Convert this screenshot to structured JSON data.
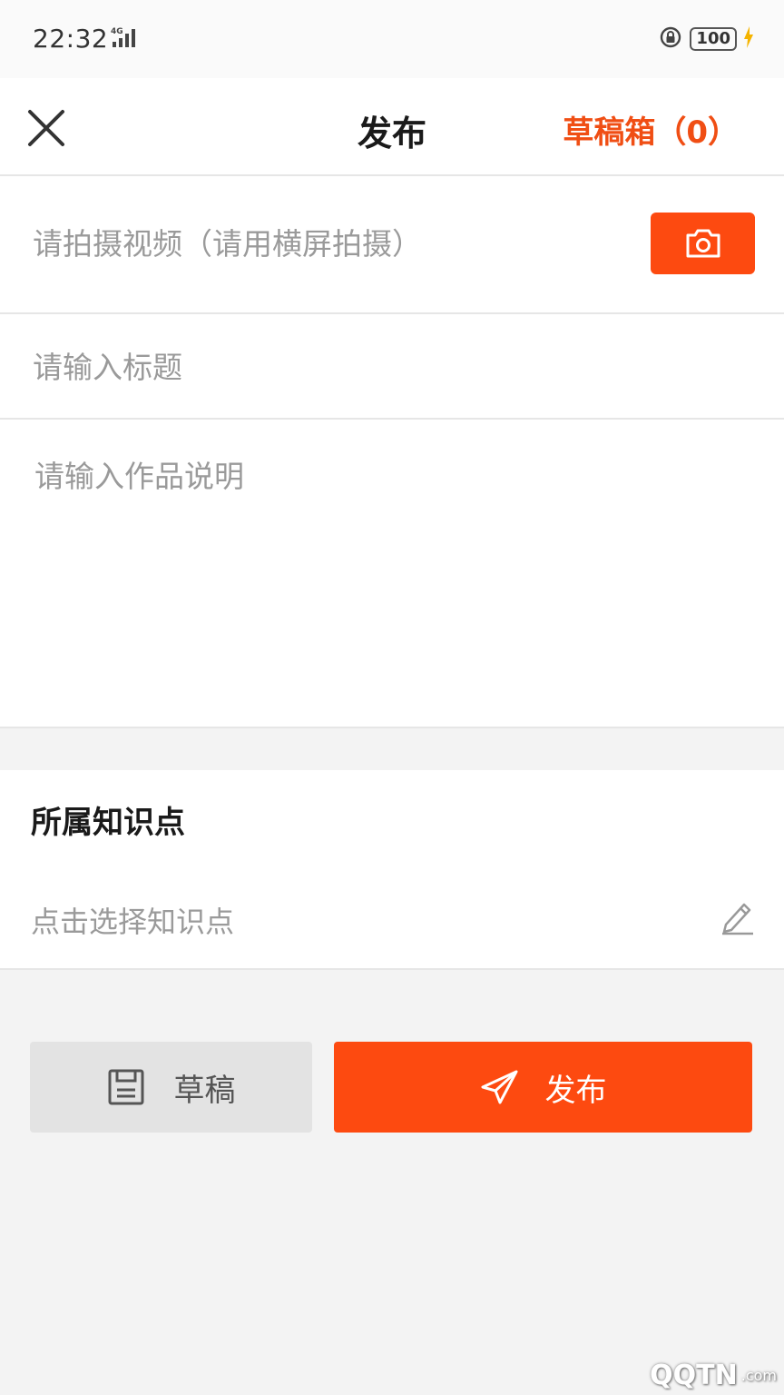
{
  "status_bar": {
    "time": "22:32",
    "network": "4G",
    "battery": "100"
  },
  "header": {
    "title": "发布",
    "drafts_link": "草稿箱（0）"
  },
  "video": {
    "prompt": "请拍摄视频（请用横屏拍摄）",
    "camera_icon": "camera-icon"
  },
  "form": {
    "title_placeholder": "请输入标题",
    "title_value": "",
    "description_placeholder": "请输入作品说明",
    "description_value": ""
  },
  "knowledge": {
    "heading": "所属知识点",
    "select_prompt": "点击选择知识点",
    "edit_icon": "pencil-icon"
  },
  "actions": {
    "draft_label": "草稿",
    "draft_icon": "save-icon",
    "publish_label": "发布",
    "publish_icon": "send-icon"
  },
  "watermark": {
    "text": "QQTN",
    "suffix": ".com"
  },
  "colors": {
    "accent": "#fd4a10",
    "link": "#f04e14"
  }
}
